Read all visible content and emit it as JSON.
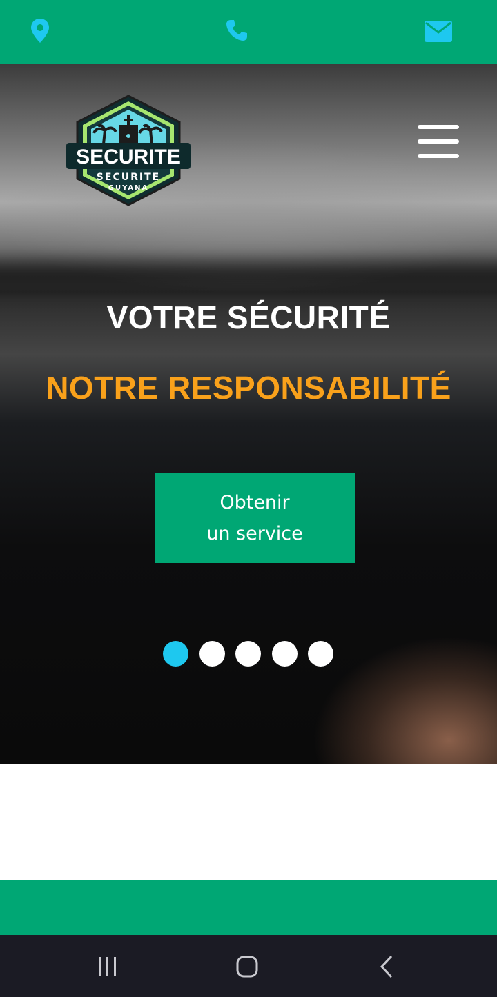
{
  "topbar": {
    "icons": [
      "location-pin-icon",
      "phone-icon",
      "envelope-icon"
    ],
    "background": "#00a774",
    "icon_color": "#1ec8ef"
  },
  "logo": {
    "word": "SECURITE",
    "line1": "SECURITE",
    "line2": "GUYANA"
  },
  "hero": {
    "title_line1": "VOTRE SÉCURITÉ",
    "title_line2": "NOTRE RESPONSABILITÉ",
    "title_line1_color": "#ffffff",
    "title_line2_color": "#f9a11b",
    "cta_line1": "Obtenir",
    "cta_line2": "un service",
    "cta_color": "#00a774",
    "slide_count": 5,
    "active_slide": 1
  },
  "android_nav": {
    "icons": [
      "recent-apps-icon",
      "home-icon",
      "back-icon"
    ]
  }
}
